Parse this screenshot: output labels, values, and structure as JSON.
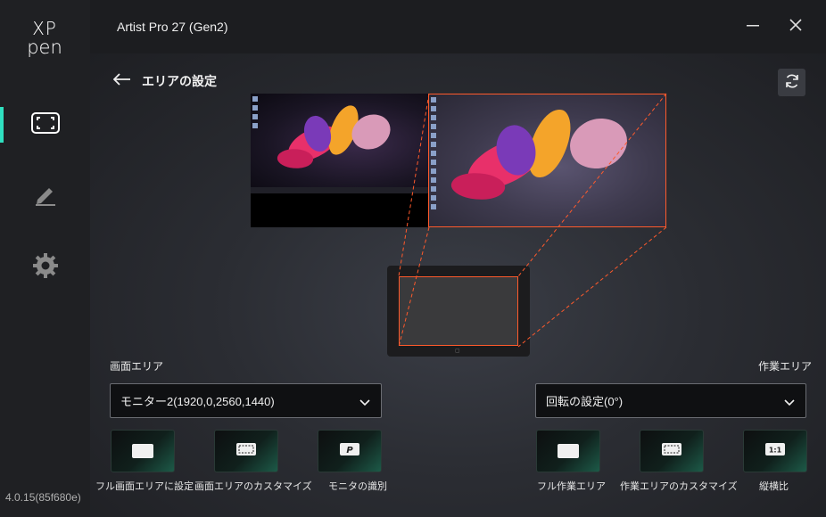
{
  "app": {
    "logo_top": "XP",
    "logo_bottom": "pen",
    "window_title": "Artist Pro 27 (Gen2)",
    "version": "4.0.15(85f680e)"
  },
  "sidebar": {
    "items": [
      {
        "name": "screen-area",
        "icon": "screen-area-icon",
        "active": true
      },
      {
        "name": "pen",
        "icon": "pen-icon",
        "active": false
      },
      {
        "name": "settings",
        "icon": "gear-icon",
        "active": false
      }
    ],
    "accent": "#2fe0c0"
  },
  "header": {
    "title": "エリアの設定"
  },
  "screen_area": {
    "label": "画面エリア",
    "selected": "モニター2(1920,0,2560,1440)",
    "actions": [
      {
        "label": "フル画面エリアに設定",
        "icon": "full-screen-icon"
      },
      {
        "label": "画面エリアのカスタマイズ",
        "icon": "custom-area-icon"
      },
      {
        "label": "モニタの識別",
        "icon": "identify-monitor-icon",
        "glyph": "P"
      }
    ]
  },
  "work_area": {
    "label": "作業エリア",
    "selected": "回転の設定(0°)",
    "actions": [
      {
        "label": "フル作業エリア",
        "icon": "full-work-area-icon"
      },
      {
        "label": "作業エリアのカスタマイズ",
        "icon": "custom-work-area-icon"
      },
      {
        "label": "縦横比",
        "icon": "aspect-ratio-icon",
        "glyph": "1:1"
      }
    ]
  },
  "colors": {
    "highlight": "#ff5a2c",
    "accent": "#2fe0c0"
  }
}
